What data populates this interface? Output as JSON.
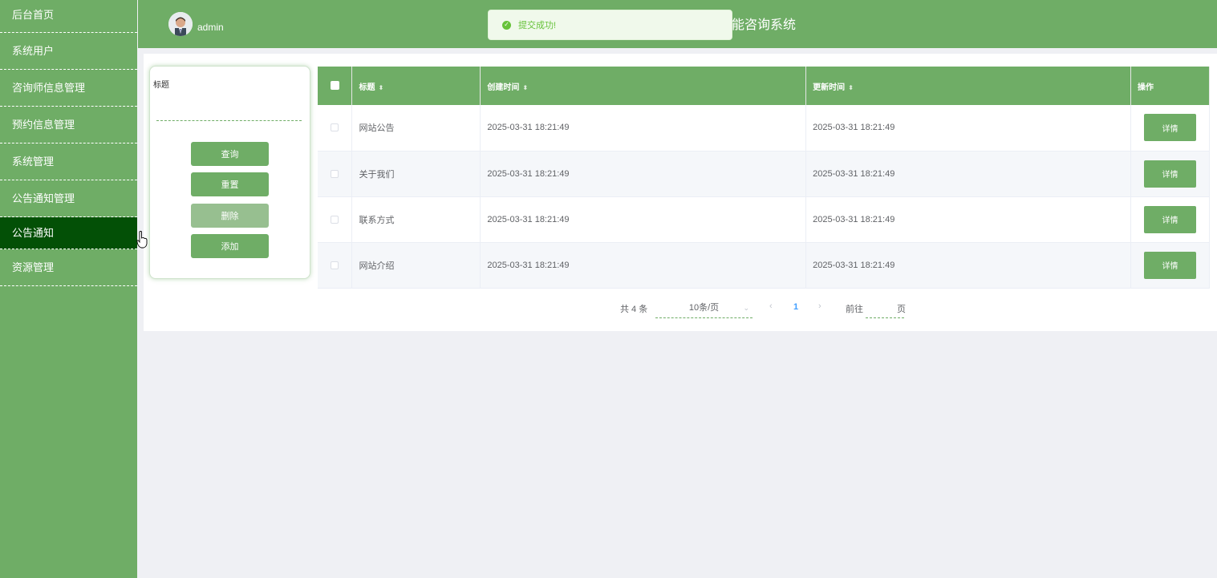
{
  "sidebar": {
    "items": [
      {
        "label": "后台首页"
      },
      {
        "label": "系统用户"
      },
      {
        "label": "咨询师信息管理"
      },
      {
        "label": "预约信息管理"
      },
      {
        "label": "系统管理"
      },
      {
        "label": "公告通知管理"
      },
      {
        "label": "公告通知"
      },
      {
        "label": "资源管理"
      }
    ],
    "active_index": 6
  },
  "header": {
    "username": "admin",
    "system_title": "能咨询系统"
  },
  "toast": {
    "message": "提交成功!",
    "type": "success"
  },
  "search": {
    "label": "标题",
    "value": "",
    "placeholder": "",
    "buttons": {
      "query": "查询",
      "reset": "重置",
      "delete": "删除",
      "add": "添加"
    }
  },
  "table": {
    "headers": {
      "title": "标题",
      "created": "创建时间",
      "updated": "更新时间",
      "actions": "操作"
    },
    "rows": [
      {
        "title": "网站公告",
        "created": "2025-03-31 18:21:49",
        "updated": "2025-03-31 18:21:49",
        "action": "详情"
      },
      {
        "title": "关于我们",
        "created": "2025-03-31 18:21:49",
        "updated": "2025-03-31 18:21:49",
        "action": "详情"
      },
      {
        "title": "联系方式",
        "created": "2025-03-31 18:21:49",
        "updated": "2025-03-31 18:21:49",
        "action": "详情"
      },
      {
        "title": "网站介绍",
        "created": "2025-03-31 18:21:49",
        "updated": "2025-03-31 18:21:49",
        "action": "详情"
      }
    ]
  },
  "pagination": {
    "total_text": "共 4 条",
    "page_size": "10条/页",
    "current_page": "1",
    "goto_label": "前往",
    "page_label": "页"
  },
  "colors": {
    "primary": "#6fad66",
    "active_sidebar": "#035006",
    "toast_bg": "#f0f9eb",
    "toast_text": "#67c23a",
    "page_bg": "#eff0f4"
  }
}
